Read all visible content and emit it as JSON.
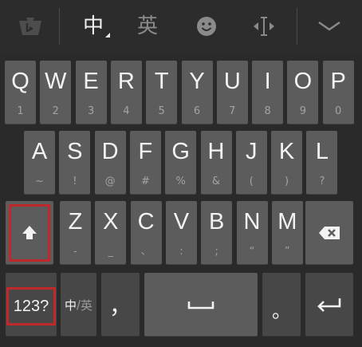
{
  "toolbar": {
    "logo_icon": "bing-logo-icon",
    "lang_zh": "中",
    "lang_en": "英",
    "emoji_icon": "smiley-icon",
    "cursor_icon": "cursor-move-icon",
    "collapse_icon": "chevron-down-icon"
  },
  "rows": {
    "row1": [
      {
        "main": "Q",
        "sub": "1"
      },
      {
        "main": "W",
        "sub": "2"
      },
      {
        "main": "E",
        "sub": "3"
      },
      {
        "main": "R",
        "sub": "4"
      },
      {
        "main": "T",
        "sub": "5"
      },
      {
        "main": "Y",
        "sub": "6"
      },
      {
        "main": "U",
        "sub": "7"
      },
      {
        "main": "I",
        "sub": "8"
      },
      {
        "main": "O",
        "sub": "9"
      },
      {
        "main": "P",
        "sub": "0"
      }
    ],
    "row2": [
      {
        "main": "A",
        "sub": "~"
      },
      {
        "main": "S",
        "sub": "!"
      },
      {
        "main": "D",
        "sub": "@"
      },
      {
        "main": "F",
        "sub": "#"
      },
      {
        "main": "G",
        "sub": "%"
      },
      {
        "main": "H",
        "sub": "&"
      },
      {
        "main": "J",
        "sub": "("
      },
      {
        "main": "K",
        "sub": ")"
      },
      {
        "main": "L",
        "sub": "?"
      }
    ],
    "row3": [
      {
        "main": "Z",
        "sub": "-"
      },
      {
        "main": "X",
        "sub": "_"
      },
      {
        "main": "C",
        "sub": "、"
      },
      {
        "main": "V",
        "sub": ":"
      },
      {
        "main": "B",
        "sub": ";"
      },
      {
        "main": "N",
        "sub": "“"
      },
      {
        "main": "M",
        "sub": "”"
      }
    ]
  },
  "bottom": {
    "numeric_label": "123?",
    "switch_zh": "中",
    "switch_sep": "/",
    "switch_en": "英",
    "comma": "，",
    "period": "。"
  },
  "colors": {
    "highlight": "#c0282b",
    "key": "#5c5c5c",
    "background": "#2a2a2a"
  }
}
